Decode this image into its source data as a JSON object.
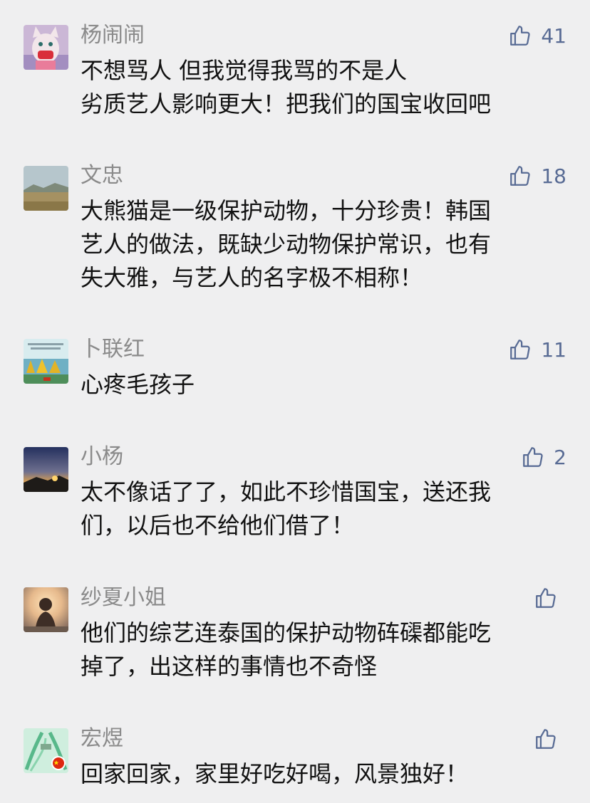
{
  "comments": [
    {
      "user": "杨闹闹",
      "likes": "41",
      "lines": [
        "不想骂人 但我觉得我骂的不是人",
        "劣质艺人影响更大！把我们的国宝收回吧"
      ]
    },
    {
      "user": "文忠",
      "likes": "18",
      "lines": [
        "大熊猫是一级保护动物，十分珍贵！韩国",
        "艺人的做法，既缺少动物保护常识，也有",
        "失大雅，与艺人的名字极不相称！"
      ]
    },
    {
      "user": "卜联红",
      "likes": "11",
      "lines": [
        "心疼毛孩子"
      ]
    },
    {
      "user": "小杨",
      "likes": "2",
      "lines": [
        "太不像话了了，如此不珍惜国宝，送还我",
        "们，以后也不给他们借了！"
      ]
    },
    {
      "user": "纱夏小姐",
      "likes": "",
      "lines": [
        "他们的综艺连泰国的保护动物砗磲都能吃",
        "掉了，出这样的事情也不奇怪"
      ]
    },
    {
      "user": "宏煜",
      "likes": "",
      "lines": [
        "回家回家，家里好吃好喝，风景独好！"
      ]
    }
  ],
  "colors": {
    "background": "#efeff0",
    "like_accent": "#586b94",
    "username": "#8a8a8a",
    "text": "#111111"
  },
  "icons": {
    "like": "thumbs-up-icon"
  }
}
